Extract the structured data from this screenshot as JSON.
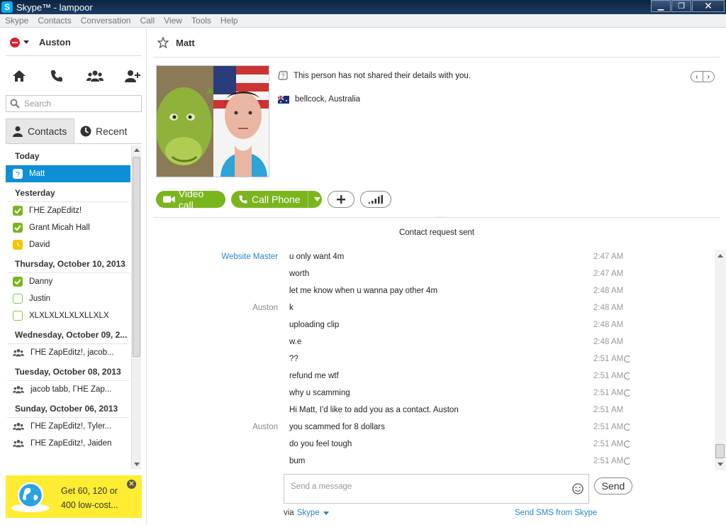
{
  "window": {
    "title": "Skype™ - lampoor",
    "app_icon": "S",
    "minimize": "▁",
    "restore": "❐",
    "close": "✕"
  },
  "menu": [
    "Skype",
    "Contacts",
    "Conversation",
    "Call",
    "View",
    "Tools",
    "Help"
  ],
  "profile": {
    "name": "Auston",
    "status": "do-not-disturb"
  },
  "nav_icons": [
    "home-icon",
    "phone-icon",
    "group-icon",
    "add-contact-icon"
  ],
  "search": {
    "placeholder": "Search"
  },
  "tabs": {
    "contacts": "Contacts",
    "recent": "Recent",
    "active": "contacts"
  },
  "recent": [
    {
      "type": "header",
      "label": "Today"
    },
    {
      "type": "contact",
      "name": "Matt",
      "status": "pending",
      "selected": true
    },
    {
      "type": "header",
      "label": "Yesterday"
    },
    {
      "type": "contact",
      "name": "ΓΗΕ ZapEditz!",
      "status": "online"
    },
    {
      "type": "contact",
      "name": "Grant Micah Hall",
      "status": "online"
    },
    {
      "type": "contact",
      "name": "David",
      "status": "away"
    },
    {
      "type": "header",
      "label": "Thursday, October 10, 2013"
    },
    {
      "type": "contact",
      "name": "Danny",
      "status": "online"
    },
    {
      "type": "contact",
      "name": "Justin",
      "status": "offline"
    },
    {
      "type": "contact",
      "name": "XLXLXLXLXLXLLXLX",
      "status": "offline"
    },
    {
      "type": "header",
      "label": "Wednesday, October 09, 2..."
    },
    {
      "type": "group",
      "name": "ΓΗΕ ZapEditz!, jacob..."
    },
    {
      "type": "header",
      "label": "Tuesday, October 08, 2013"
    },
    {
      "type": "group",
      "name": "jacob tabb, ΓΗΕ Zap..."
    },
    {
      "type": "header",
      "label": "Sunday, October 06, 2013"
    },
    {
      "type": "group",
      "name": "ΓΗΕ ZapEditz!, Tyler..."
    },
    {
      "type": "group",
      "name": "ΓΗΕ ZapEditz!, Jaiden"
    }
  ],
  "promo": {
    "line1": "Get 60, 120 or",
    "line2": "400 low-cost...",
    "close": "✕"
  },
  "conversation": {
    "title": "Matt",
    "info": "This person has not shared their details with you.",
    "location": "bellcock, Australia",
    "pager_prev": "‹",
    "pager_next": "›",
    "video_call": "Video call",
    "call_phone": "Call Phone",
    "separator": "...",
    "request_text": "Contact request sent"
  },
  "messages": [
    {
      "sender": "Website Master",
      "sender_link": true,
      "text": "u only want 4m",
      "time": "2:47 AM",
      "sending": false
    },
    {
      "sender": "",
      "text": "worth",
      "time": "2:47 AM",
      "sending": false
    },
    {
      "sender": "",
      "text": "let me know when u wanna pay other 4m",
      "time": "2:48 AM",
      "sending": false
    },
    {
      "sender": "Auston",
      "text": "k",
      "time": "2:48 AM",
      "sending": false
    },
    {
      "sender": "",
      "text": "uploading clip",
      "time": "2:48 AM",
      "sending": false
    },
    {
      "sender": "",
      "text": "w.e",
      "time": "2:48 AM",
      "sending": false
    },
    {
      "sender": "",
      "text": "??",
      "time": "2:51 AM",
      "sending": true
    },
    {
      "sender": "",
      "text": "refund me wtf",
      "time": "2:51 AM",
      "sending": true
    },
    {
      "sender": "",
      "text": "why u scamming",
      "time": "2:51 AM",
      "sending": true
    },
    {
      "sender": "",
      "text": "Hi Matt, I'd like to add you as a contact. Auston",
      "time": "2:51 AM",
      "sending": false
    },
    {
      "sender": "Auston",
      "text": "you scammed for 8 dollars",
      "time": "2:51 AM",
      "sending": true
    },
    {
      "sender": "",
      "text": "do you feel tough",
      "time": "2:51 AM",
      "sending": true
    },
    {
      "sender": "",
      "text": "bum",
      "time": "2:51 AM",
      "sending": true
    }
  ],
  "compose": {
    "placeholder": "Send a message",
    "send_label": "Send",
    "via_label": "via",
    "via_service": "Skype",
    "sms_link": "Send SMS from Skype"
  },
  "colors": {
    "accent": "#0d8fd6",
    "green": "#7ab51d",
    "promo": "#ffec33",
    "link": "#2a86c8"
  }
}
